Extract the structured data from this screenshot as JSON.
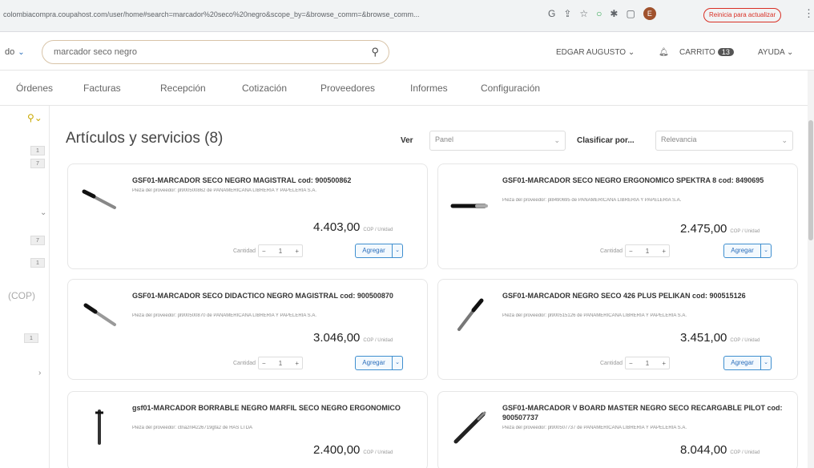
{
  "browser": {
    "url": "colombiacompra.coupahost.com/user/home#search=marcador%20seco%20negro&scope_by=&browse_comm=&browse_comm...",
    "update_label": "Reinicia para actualizar"
  },
  "header": {
    "scope_label": "do",
    "search_value": "marcador seco negro",
    "user_label": "EDGAR AUGUSTO",
    "cart_label": "CARRITO",
    "cart_count": "13",
    "help_label": "AYUDA"
  },
  "nav": {
    "items": [
      "Órdenes",
      "Facturas",
      "Recepción",
      "Cotización",
      "Proveedores",
      "Informes",
      "Configuración"
    ]
  },
  "left_panel": {
    "chips": [
      "1",
      "7",
      "7",
      "1",
      "1"
    ],
    "currency": "(COP)"
  },
  "main": {
    "title": "Artículos y servicios (8)",
    "view_label": "Ver",
    "view_value": "Panel",
    "sort_label": "Clasificar por...",
    "sort_value": "Relevancia"
  },
  "products": [
    {
      "title": "GSF01-MARCADOR SECO NEGRO MAGISTRAL cod: 900500862",
      "supplier": "Pieza del proveedor: pl900500862 de PANAMERICANA LIBRERÍA Y PAPELERÍA S.A.",
      "price": "4.403,00",
      "unit": "COP / Unidad",
      "qty_label": "Cantidad",
      "qty": "1",
      "add_label": "Agregar"
    },
    {
      "title": "GSF01-MARCADOR SECO NEGRO ERGONOMICO SPEKTRA 8 cod: 8490695",
      "supplier": "Pieza del proveedor: pl8490695 de PANAMERICANA LIBRERÍA Y PAPELERÍA S.A.",
      "price": "2.475,00",
      "unit": "COP / Unidad",
      "qty_label": "Cantidad",
      "qty": "1",
      "add_label": "Agregar"
    },
    {
      "title": "GSF01-MARCADOR SECO DIDACTICO NEGRO MAGISTRAL cod: 900500870",
      "supplier": "Pieza del proveedor: pl900500870 de PANAMERICANA LIBRERÍA Y PAPELERÍA S.A.",
      "price": "3.046,00",
      "unit": "COP / Unidad",
      "qty_label": "Cantidad",
      "qty": "1",
      "add_label": "Agregar"
    },
    {
      "title": "GSF01-MARCADOR NEGRO SECO 426 PLUS PELIKAN cod: 900515126",
      "supplier": "Pieza del proveedor: pl900515126 de PANAMERICANA LIBRERÍA Y PAPELERÍA S.A.",
      "price": "3.451,00",
      "unit": "COP / Unidad",
      "qty_label": "Cantidad",
      "qty": "1",
      "add_label": "Agregar"
    },
    {
      "title": "gsf01-MARCADOR BORRABLE NEGRO MARFIL SECO NEGRO ERGONOMICO",
      "supplier": "Pieza del proveedor: ctna2nl4226719gfa2 de HAS LTDA",
      "price": "2.400,00",
      "unit": "COP / Unidad",
      "qty_label": "Cantidad",
      "qty": "1",
      "add_label": "Agregar"
    },
    {
      "title": "GSF01-MARCADOR V BOARD MASTER NEGRO SECO RECARGABLE PILOT cod: 900507737",
      "supplier": "Pieza del proveedor: pl900507737 de PANAMERICANA LIBRERÍA Y PAPELERÍA S.A.",
      "price": "8.044,00",
      "unit": "COP / Unidad",
      "qty_label": "Cantidad",
      "qty": "1",
      "add_label": "Agregar"
    }
  ]
}
